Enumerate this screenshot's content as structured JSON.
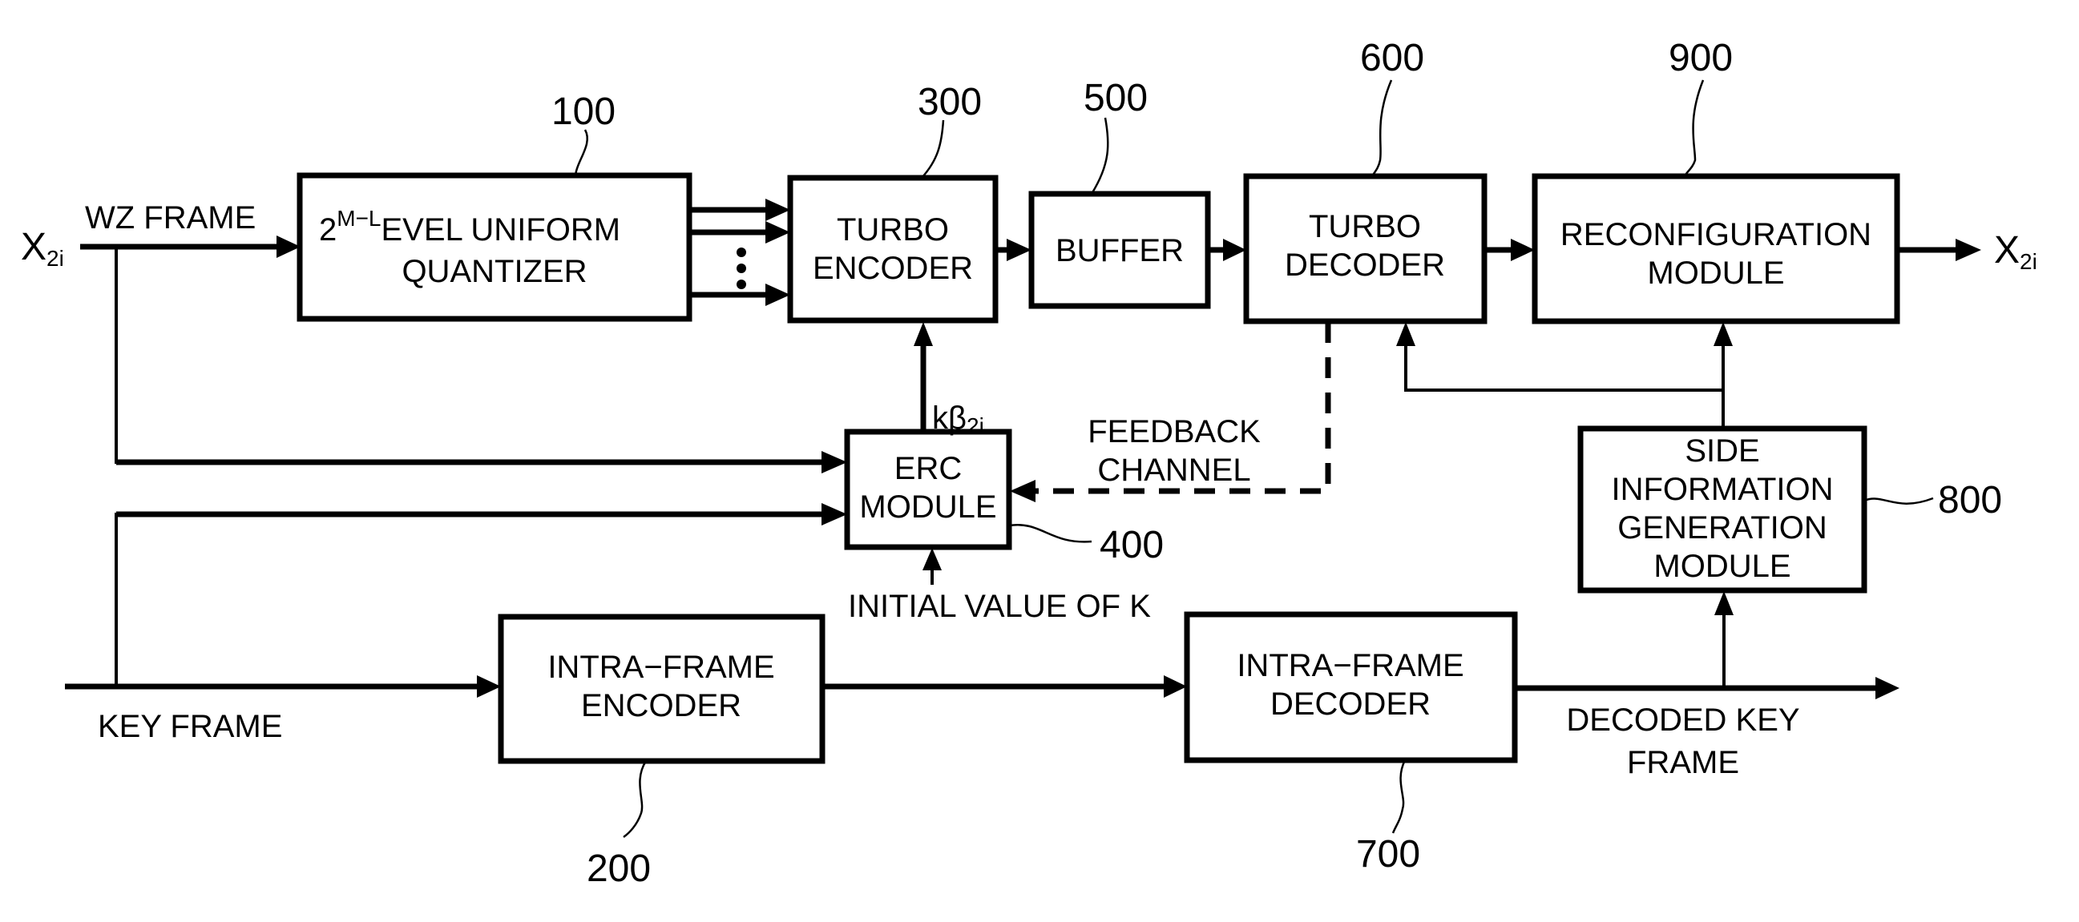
{
  "figure": {
    "blocks": {
      "quantizer": {
        "ref": "100",
        "line1_base": "2",
        "line1_sup": "M−L",
        "line1_rest": "EVEL UNIFORM",
        "line2": "QUANTIZER"
      },
      "intra_encoder": {
        "ref": "200",
        "line1": "INTRA−FRAME",
        "line2": "ENCODER"
      },
      "turbo_encoder": {
        "ref": "300",
        "line1": "TURBO",
        "line2": "ENCODER"
      },
      "erc_module": {
        "ref": "400",
        "line1": "ERC",
        "line2": "MODULE"
      },
      "buffer": {
        "ref": "500",
        "line1": "BUFFER"
      },
      "turbo_decoder": {
        "ref": "600",
        "line1": "TURBO",
        "line2": "DECODER"
      },
      "intra_decoder": {
        "ref": "700",
        "line1": "INTRA−FRAME",
        "line2": "DECODER"
      },
      "side_info": {
        "ref": "800",
        "line1": "SIDE",
        "line2": "INFORMATION",
        "line3": "GENERATION",
        "line4": "MODULE"
      },
      "reconfiguration": {
        "ref": "900",
        "line1": "RECONFIGURATION",
        "line2": "MODULE"
      }
    },
    "signals": {
      "input_x": "X",
      "input_x_sub": "2i",
      "wz_frame": "WZ FRAME",
      "key_frame": "KEY FRAME",
      "k_beta": "kβ",
      "k_beta_sub": "2i",
      "feedback_line1": "FEEDBACK",
      "feedback_line2": "CHANNEL",
      "initial_k": "INITIAL VALUE OF K",
      "decoded_key_line1": "DECODED KEY",
      "decoded_key_line2": "FRAME",
      "output_x": "X",
      "output_x_sub": "2i",
      "ellipsis": "⋮"
    }
  }
}
